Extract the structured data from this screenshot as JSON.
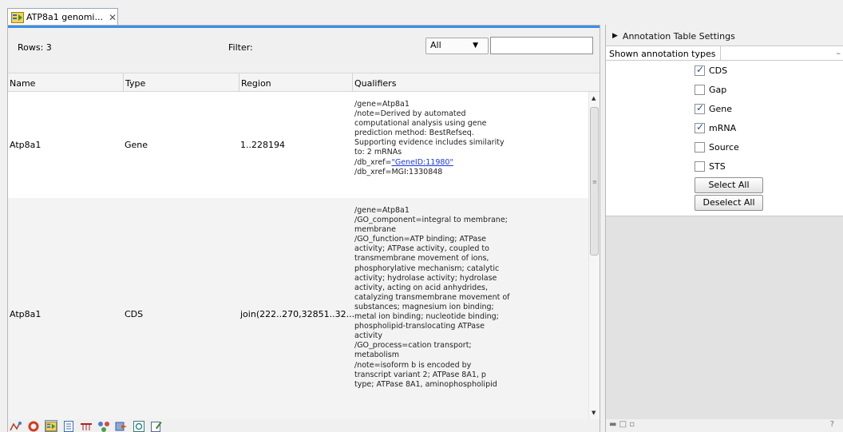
{
  "tab": {
    "icon": "annotation-table-icon",
    "title": "ATP8a1 genomi...",
    "close_symbol": "✕"
  },
  "toolbar": {
    "rows_label": "Rows: 3",
    "filter_label": "Filter:",
    "filter_select_value": "All",
    "filter_input_value": ""
  },
  "table": {
    "columns": [
      "Name",
      "Type",
      "Region",
      "Qualifiers"
    ],
    "rows": [
      {
        "name": "Atp8a1",
        "type": "Gene",
        "region": "1..228194",
        "qualifiers": [
          "/gene=Atp8a1",
          "/note=Derived by automated",
          "computational analysis using gene",
          "prediction method: BestRefseq.",
          "Supporting evidence includes similarity",
          "to: 2 mRNAs"
        ],
        "link_prefix": "/db_xref=",
        "link_text": "\"GeneID:11980\"",
        "qualifiers_after": [
          "/db_xref=MGI:1330848"
        ]
      },
      {
        "name": "Atp8a1",
        "type": "CDS",
        "region": "join(222..270,32851..32...",
        "qualifiers": [
          "/gene=Atp8a1",
          "/GO_component=integral to membrane;",
          "membrane",
          "/GO_function=ATP binding; ATPase",
          "activity; ATPase activity, coupled to",
          "transmembrane movement of ions,",
          "phosphorylative mechanism; catalytic",
          "activity; hydrolase activity; hydrolase",
          "activity, acting on acid anhydrides,",
          "catalyzing transmembrane movement of",
          "substances; magnesium ion binding;",
          "metal ion binding; nucleotide binding;",
          "phospholipid-translocating ATPase",
          "activity",
          "/GO_process=cation transport;",
          "metabolism",
          "/note=isoform b is encoded by",
          "transcript variant 2; ATPase 8A1, p",
          "type; ATPase 8A1, aminophospholipid"
        ]
      }
    ]
  },
  "bottom_toolbar": {
    "icons": [
      "rna-structure-icon",
      "circular-view-icon",
      "annotation-table-icon",
      "text-view-icon",
      "sequence-list-icon",
      "graph-view-icon",
      "history-icon",
      "element-info-icon",
      "edit-icon"
    ]
  },
  "settings": {
    "header": "Annotation Table Settings",
    "section_title": "Shown annotation types",
    "checkboxes": [
      {
        "label": "CDS",
        "checked": true
      },
      {
        "label": "Gap",
        "checked": false
      },
      {
        "label": "Gene",
        "checked": true
      },
      {
        "label": "mRNA",
        "checked": true
      },
      {
        "label": "Source",
        "checked": false
      },
      {
        "label": "STS",
        "checked": false
      }
    ],
    "select_all_label": "Select All",
    "deselect_all_label": "Deselect All",
    "help_symbol": "?"
  },
  "colors": {
    "accent": "#3a8ee6",
    "link": "#1a37e0",
    "checkmark": "#1d4f9e"
  }
}
